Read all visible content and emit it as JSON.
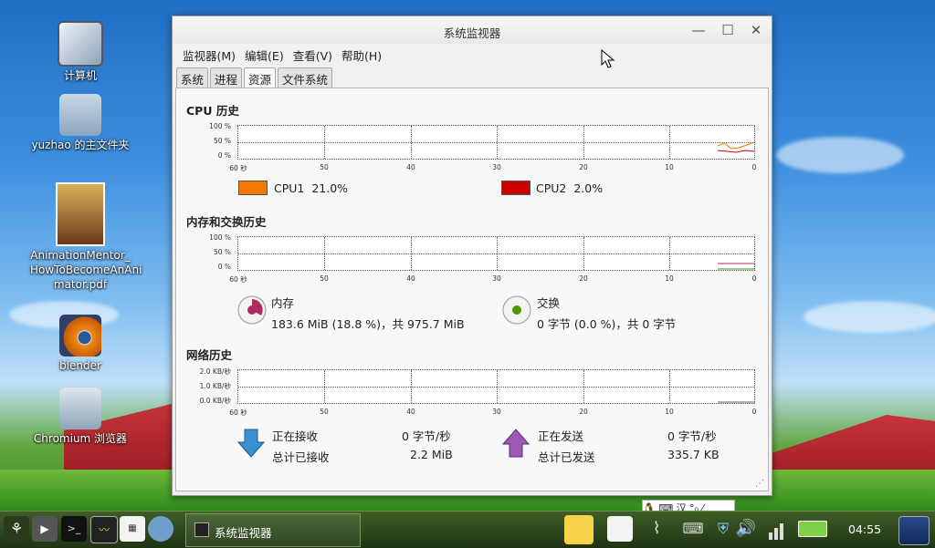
{
  "desktop": {
    "icons": [
      {
        "label": "计算机"
      },
      {
        "label": "yuzhao 的主文件夹"
      },
      {
        "label": "AnimationMentor_HowToBecomeAnAnimator.pdf",
        "lines": [
          "AnimationMentor_",
          "HowToBecomeAnAni",
          "mator.pdf"
        ]
      },
      {
        "label": "blender"
      },
      {
        "label": "Chromium 浏览器"
      }
    ]
  },
  "window": {
    "title": "系统监视器",
    "menu": [
      "监视器(M)",
      "编辑(E)",
      "查看(V)",
      "帮助(H)"
    ],
    "tabs": [
      "系统",
      "进程",
      "资源",
      "文件系统"
    ],
    "active_tab": "资源"
  },
  "cpu": {
    "title": "CPU 历史",
    "y_ticks": [
      "100 %",
      "50 %",
      "0 %"
    ],
    "x_ticks": [
      "60 秒",
      "50",
      "40",
      "30",
      "20",
      "10",
      "0"
    ],
    "cpu1": {
      "label": "CPU1",
      "value": "21.0%",
      "color": "#f57900"
    },
    "cpu2": {
      "label": "CPU2",
      "value": "2.0%",
      "color": "#cc0000"
    }
  },
  "memory": {
    "title": "内存和交换历史",
    "y_ticks": [
      "100 %",
      "50 %",
      "0 %"
    ],
    "x_ticks": [
      "60 秒",
      "50",
      "40",
      "30",
      "20",
      "10",
      "0"
    ],
    "mem_label": "内存",
    "mem_value": "183.6 MiB (18.8 %)，共 975.7 MiB",
    "mem_color": "#ad2c60",
    "swap_label": "交换",
    "swap_value": "0 字节 (0.0 %)，共 0 字节",
    "swap_color": "#4e9a06"
  },
  "network": {
    "title": "网络历史",
    "y_ticks": [
      "2.0 KB/秒",
      "1.0 KB/秒",
      "0.0 KB/秒"
    ],
    "x_ticks": [
      "60 秒",
      "50",
      "40",
      "30",
      "20",
      "10",
      "0"
    ],
    "recv_label": "正在接收",
    "recv_value": "0 字节/秒",
    "total_recv_label": "总计已接收",
    "total_recv_value": "2.2 MiB",
    "send_label": "正在发送",
    "send_value": "0 字节/秒",
    "total_send_label": "总计已发送",
    "total_send_value": "335.7 KB"
  },
  "taskbar": {
    "task_label": "系统监视器",
    "clock": "04:55"
  }
}
